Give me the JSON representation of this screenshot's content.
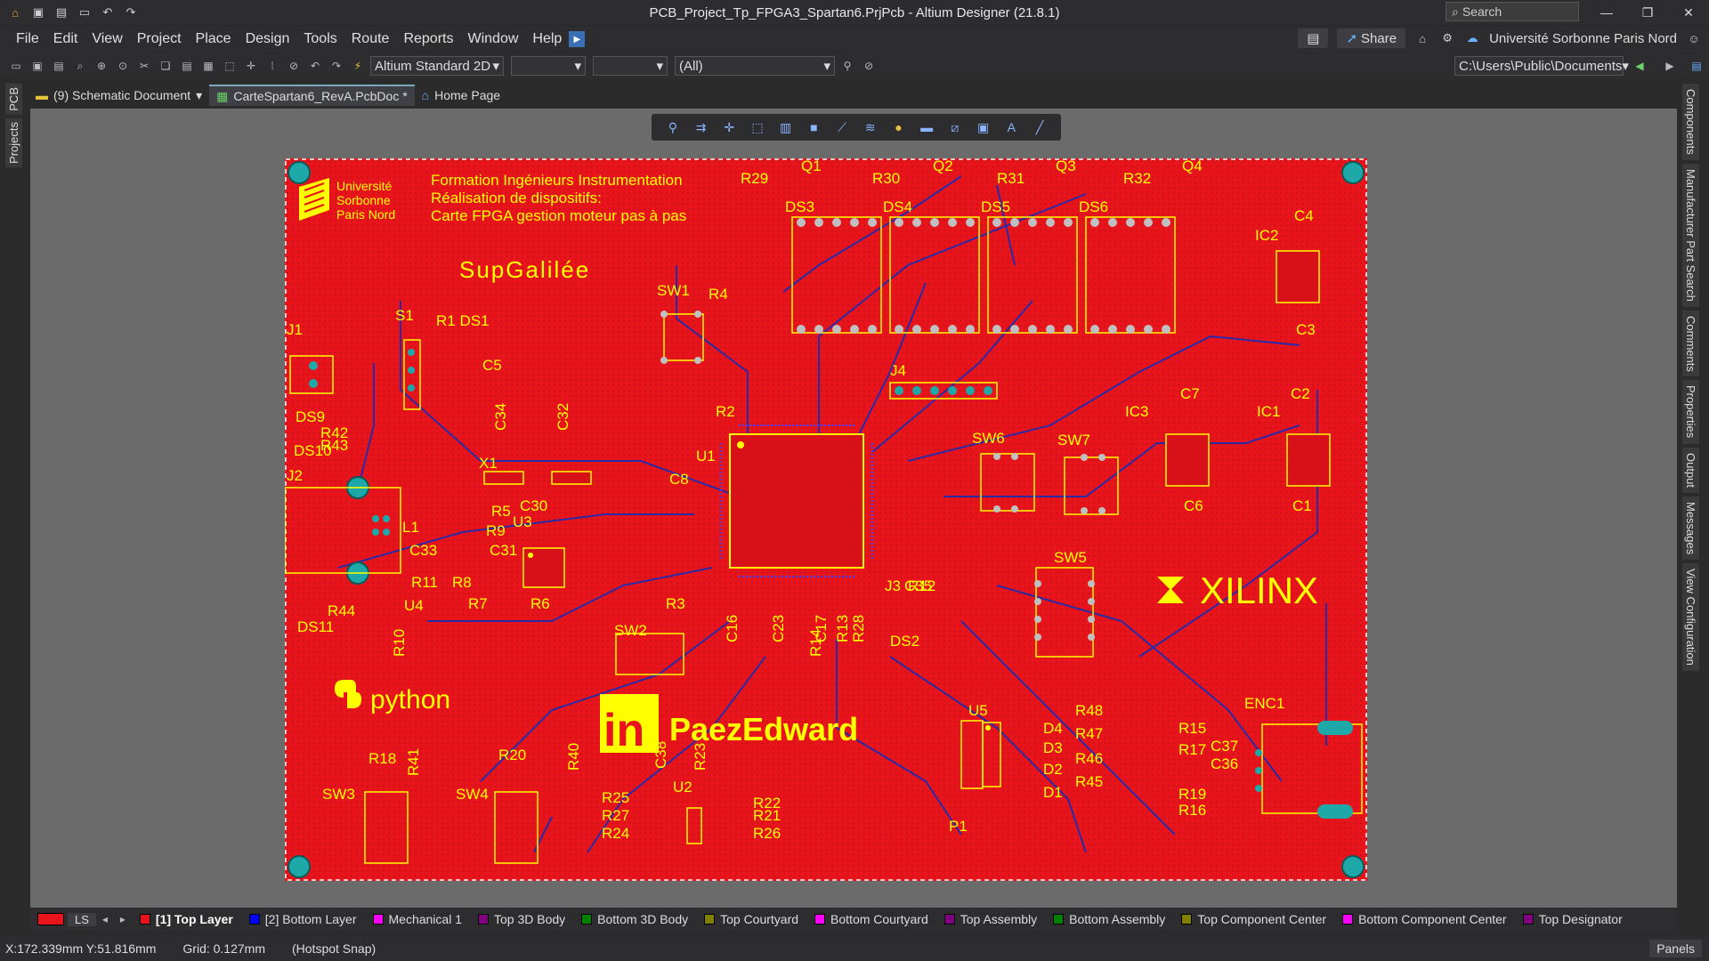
{
  "window": {
    "title": "PCB_Project_Tp_FPGA3_Spartan6.PrjPcb - Altium Designer (21.8.1)",
    "search_label": "Search"
  },
  "menu": {
    "items": [
      "File",
      "Edit",
      "View",
      "Project",
      "Place",
      "Design",
      "Tools",
      "Route",
      "Reports",
      "Window",
      "Help"
    ],
    "share_label": "Share",
    "workspace": "Université Sorbonne Paris Nord"
  },
  "toolbar": {
    "view_config": "Altium Standard 2D",
    "filter_value": "(All)",
    "path": "C:\\Users\\Public\\Documents"
  },
  "tabs": [
    {
      "label": "(9) Schematic Document"
    },
    {
      "label": "CarteSpartan6_RevA.PcbDoc *"
    },
    {
      "label": "Home Page"
    }
  ],
  "left_panels": [
    "PCB",
    "Projects"
  ],
  "right_panels": [
    "Components",
    "Manufacturer Part Search",
    "Comments",
    "Properties",
    "Output",
    "Messages",
    "View Configuration"
  ],
  "board": {
    "header_lines": [
      "Formation Ingénieurs Instrumentation",
      "Réalisation de dispositifs:",
      "Carte FPGA gestion moteur pas à pas"
    ],
    "univ_lines": [
      "Université",
      "Sorbonne",
      "Paris Nord"
    ],
    "supgalilee": "SupGalilée",
    "xilinx": "XILINX",
    "python": "python",
    "linkedin_name": "PaezEdward",
    "labels": [
      "R29",
      "Q1",
      "R30",
      "Q2",
      "R31",
      "Q3",
      "R32",
      "Q4",
      "DS3",
      "DS4",
      "DS5",
      "DS6",
      "C4",
      "IC2",
      "C3",
      "J1",
      "S1",
      "R1 DS1",
      "C5",
      "SW1",
      "R4",
      "J4",
      "C7",
      "C2",
      "IC3",
      "IC1",
      "DS9",
      "R42",
      "R43",
      "DS10",
      "J2",
      "C34",
      "C32",
      "X1",
      "R2",
      "U1",
      "C8",
      "SW6",
      "SW7",
      "C6",
      "C1",
      "L1",
      "R5",
      "C30",
      "R9",
      "U3",
      "C33",
      "C31",
      "R11",
      "R8",
      "R6",
      "R7",
      "R3",
      "J3",
      "C35",
      "R12",
      "SW5",
      "DS11",
      "R44",
      "U4",
      "R10",
      "SW2",
      "C16",
      "C23",
      "C17",
      "R28",
      "R13",
      "R14",
      "DS2",
      "U5",
      "D4",
      "R48",
      "D3",
      "R47",
      "D2",
      "R46",
      "D1",
      "R45",
      "R15",
      "ENC1",
      "R17",
      "C37",
      "C36",
      "R19",
      "R16",
      "R18",
      "R20",
      "SW3",
      "SW4",
      "R41",
      "R40",
      "R23",
      "C38",
      "U2",
      "R25",
      "R22",
      "R27",
      "R21",
      "R24",
      "R26",
      "P1"
    ],
    "colors": {
      "board": "#e8141b",
      "text": "#ffff00",
      "track": "#2a2aa8",
      "pad": "#c0c0c0",
      "mount": "#1fa8a8"
    }
  },
  "layers": [
    {
      "name": "[1] Top Layer",
      "color": "#e8141b",
      "active": true
    },
    {
      "name": "[2] Bottom Layer",
      "color": "#0000ff",
      "active": false
    },
    {
      "name": "Mechanical 1",
      "color": "#ff00ff",
      "active": false
    },
    {
      "name": "Top 3D Body",
      "color": "#800080",
      "active": false
    },
    {
      "name": "Bottom 3D Body",
      "color": "#008000",
      "active": false
    },
    {
      "name": "Top Courtyard",
      "color": "#808000",
      "active": false
    },
    {
      "name": "Bottom Courtyard",
      "color": "#ff00ff",
      "active": false
    },
    {
      "name": "Top Assembly",
      "color": "#800080",
      "active": false
    },
    {
      "name": "Bottom Assembly",
      "color": "#008000",
      "active": false
    },
    {
      "name": "Top Component Center",
      "color": "#808000",
      "active": false
    },
    {
      "name": "Bottom Component Center",
      "color": "#ff00ff",
      "active": false
    },
    {
      "name": "Top Designator",
      "color": "#800080",
      "active": false
    }
  ],
  "layerbar": {
    "ls_label": "LS"
  },
  "status": {
    "coords": "X:172.339mm Y:51.816mm",
    "grid": "Grid: 0.127mm",
    "snap": "(Hotspot Snap)",
    "panels_label": "Panels"
  }
}
